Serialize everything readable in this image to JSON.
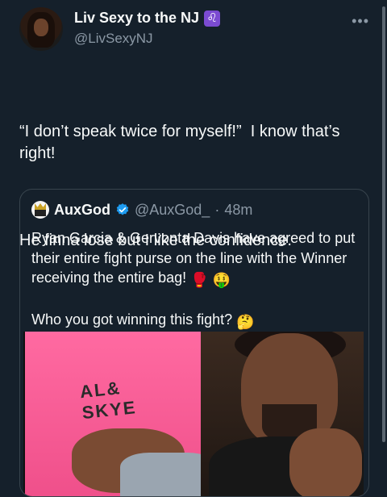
{
  "author": {
    "display_name": "Liv Sexy to the NJ",
    "zodiac_badge": "♌",
    "handle": "@LivSexyNJ",
    "more_icon": "more-horizontal-icon"
  },
  "tweet": {
    "paragraphs": [
      "“I don’t speak twice for myself!”  I know that’s right!",
      "He finna lose but I like the confidence."
    ]
  },
  "quoted_tweet": {
    "display_name": "AuxGod",
    "verified_icon": "verified-badge-icon",
    "handle": "@AuxGod_",
    "separator": "·",
    "time": "48m",
    "text_line1": "Ryan Garcia & Gervonta Davis have agreed to put their entire fight purse on the line with the Winner receiving the entire bag! ",
    "emoji1": "🥊",
    "emoji2": "🤑",
    "text_line2": "Who you got winning this fight? ",
    "emoji3": "🤔",
    "shirt_print": "AL& SKYE",
    "accent_color": "#1d9bf0"
  }
}
